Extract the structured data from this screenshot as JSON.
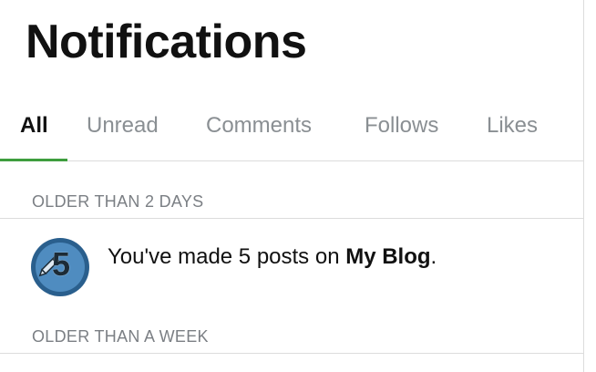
{
  "header": {
    "title": "Notifications"
  },
  "tabs": [
    {
      "label": "All",
      "active": true
    },
    {
      "label": "Unread",
      "active": false
    },
    {
      "label": "Comments",
      "active": false
    },
    {
      "label": "Follows",
      "active": false
    },
    {
      "label": "Likes",
      "active": false
    }
  ],
  "sections": [
    {
      "label": "OLDER THAN 2 DAYS",
      "items": [
        {
          "badge_number": "5",
          "badge_icon": "pencil-icon",
          "text_prefix": "You've made 5 posts on ",
          "text_strong": "My Blog",
          "text_suffix": "."
        }
      ]
    },
    {
      "label": "OLDER THAN A WEEK",
      "items": []
    }
  ],
  "colors": {
    "accent_green": "#3e9e3e",
    "badge_outer": "#2a5f8d",
    "badge_inner": "#4f8cc0",
    "muted_text": "#8a8f93",
    "divider": "#dcdcdc"
  }
}
